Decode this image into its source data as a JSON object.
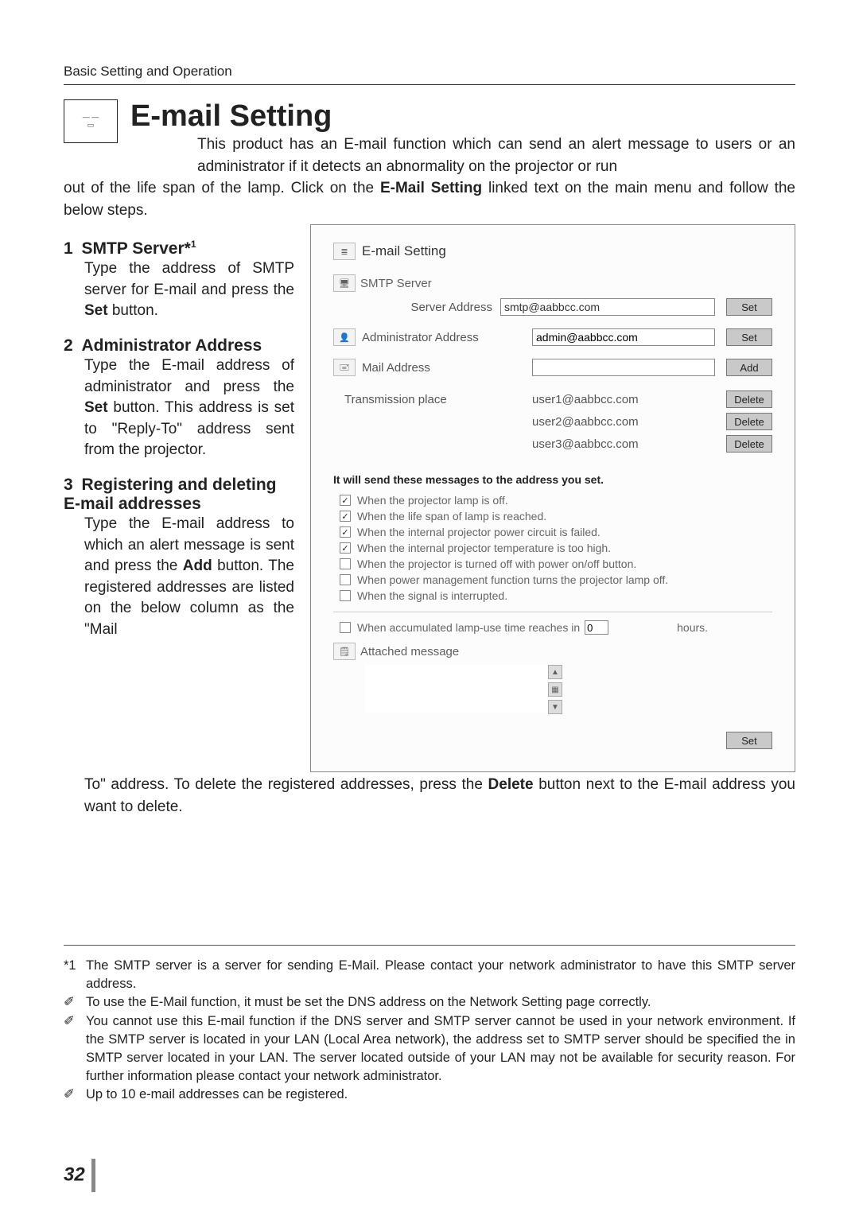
{
  "header": {
    "breadcrumb": "Basic Setting and Operation"
  },
  "title": "E-mail Setting",
  "intro_part1": "This product has an E-mail function which can send an alert message to users or an administrator if it detects an abnormality on the projector or run",
  "intro_part2": "out of the life span of the lamp. Click on the ",
  "intro_linktext": "E-Mail Setting",
  "intro_part3": " linked text on the main menu and follow the below steps.",
  "steps": {
    "one": {
      "num": "1",
      "title": "SMTP Server*",
      "sup": "1",
      "body": "Type the address of SMTP server for E-mail and press the ",
      "body_bold": "Set",
      "body_after": " button."
    },
    "two": {
      "num": "2",
      "title": "Administrator Address",
      "body1": "Type the E-mail address of administrator and press the ",
      "body_bold": "Set",
      "body2": " button. This address is set to \"Reply-To\" address sent from the projector."
    },
    "three": {
      "num": "3",
      "title": "Registering and deleting E-mail addresses",
      "body1": "Type the E-mail address to which an alert message is sent and press the ",
      "body_bold": "Add",
      "body2": " button. The registered addresses are listed on the below column as the \"Mail"
    }
  },
  "after_panel1": "To\" address. To delete the registered addresses, press the ",
  "after_panel_bold": "Delete",
  "after_panel2": " button next to the E-mail address you want to delete.",
  "panel": {
    "title": "E-mail Setting",
    "smtp_label": "SMTP Server",
    "server_address_label": "Server Address",
    "server_address_value": "smtp@aabbcc.com",
    "set_btn": "Set",
    "admin_label": "Administrator Address",
    "admin_value": "admin@aabbcc.com",
    "mail_label": "Mail Address",
    "mail_value": "",
    "add_btn": "Add",
    "trans_label": "Transmission place",
    "trans_emails": [
      "user1@aabbcc.com",
      "user2@aabbcc.com",
      "user3@aabbcc.com"
    ],
    "delete_btn": "Delete",
    "conditions_heading": "It will send these messages to the address you set.",
    "checks": [
      {
        "checked": true,
        "label": "When the projector lamp is off."
      },
      {
        "checked": true,
        "label": "When the life span of lamp is reached."
      },
      {
        "checked": true,
        "label": "When the internal projector power circuit is failed."
      },
      {
        "checked": true,
        "label": "When the internal projector temperature is too high."
      },
      {
        "checked": false,
        "label": "When the projector is turned off with power on/off button."
      },
      {
        "checked": false,
        "label": "When power management function turns the projector lamp off."
      },
      {
        "checked": false,
        "label": "When the signal is interrupted."
      }
    ],
    "accum_prefix": "When accumulated lamp-use time reaches in",
    "accum_value": "0",
    "accum_suffix": "hours.",
    "attached_label": "Attached message"
  },
  "footnotes": {
    "f1": "The SMTP server is a server for sending E-Mail. Please contact your network administrator to have this SMTP server address.",
    "f2": "To use the E-Mail function, it must be set the DNS address on the Network Setting page correctly.",
    "f3": "You cannot use this E-mail function if the DNS server and SMTP server cannot be used in your network environment. If the SMTP server is located in your LAN (Local Area network), the address set to SMTP server should be specified the in SMTP server located in your LAN. The server located outside of your LAN may not be available for security reason. For further information please contact your network administrator.",
    "f4": "Up to 10 e-mail addresses can be registered."
  },
  "page_number": "32"
}
